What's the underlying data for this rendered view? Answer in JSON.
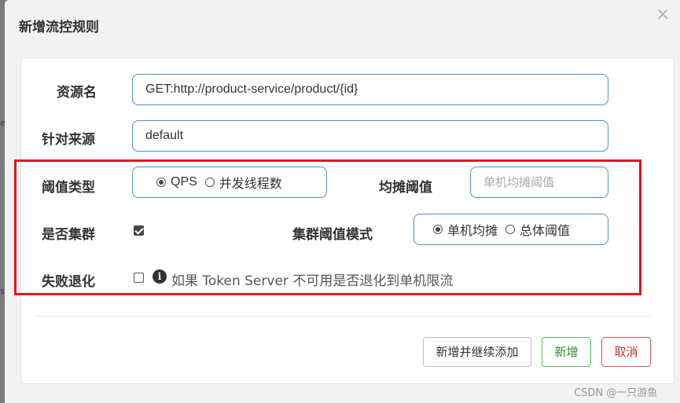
{
  "dialog": {
    "title": "新增流控规则",
    "close_glyph": "×"
  },
  "form": {
    "resource": {
      "label": "资源名",
      "value": "GET:http://product-service/product/{id}"
    },
    "limit_app": {
      "label": "针对来源",
      "value": "default"
    },
    "threshold_type": {
      "label": "阈值类型",
      "options": [
        {
          "label": "QPS",
          "checked": true
        },
        {
          "label": "并发线程数",
          "checked": false
        }
      ]
    },
    "shared_threshold": {
      "label": "均摊阈值",
      "placeholder": "单机均摊阈值"
    },
    "cluster": {
      "label": "是否集群",
      "checked": true
    },
    "cluster_threshold_mode": {
      "label": "集群阈值模式",
      "options": [
        {
          "label": "单机均摊",
          "checked": true
        },
        {
          "label": "总体阈值",
          "checked": false
        }
      ]
    },
    "fallback": {
      "label": "失败退化",
      "checked": false,
      "hint": "如果 Token Server 不可用是否退化到单机限流"
    }
  },
  "footer": {
    "add_continue_label": "新增并继续添加",
    "add_label": "新增",
    "cancel_label": "取消"
  },
  "watermark": "CSDN @一只游鱼",
  "edge_glyphs": [
    "e",
    "s"
  ],
  "colors": {
    "input_border": "#4a90d9",
    "highlight": "#e8141c",
    "success": "#5cb85c",
    "danger": "#d9534f"
  },
  "icons": {
    "info": "info-icon",
    "close": "close-icon"
  }
}
